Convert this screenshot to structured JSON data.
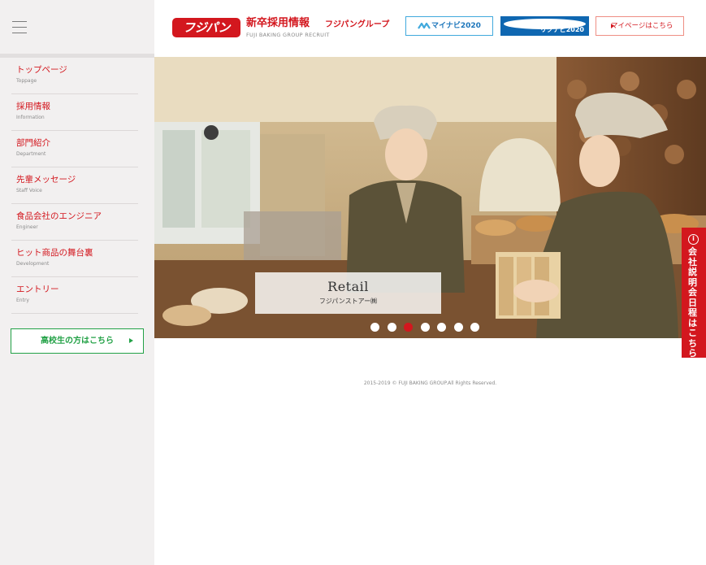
{
  "sidebar": {
    "menu_icon": "hamburger-menu-icon",
    "items": [
      {
        "jp": "トップページ",
        "en": "Toppage"
      },
      {
        "jp": "採用情報",
        "en": "Information"
      },
      {
        "jp": "部門紹介",
        "en": "Department"
      },
      {
        "jp": "先輩メッセージ",
        "en": "Staff Voice"
      },
      {
        "jp": "食品会社のエンジニア",
        "en": "Engineer"
      },
      {
        "jp": "ヒット商品の舞台裏",
        "en": "Development"
      },
      {
        "jp": "エントリー",
        "en": "Entry"
      }
    ],
    "highschool_button": "高校生の方はこちら"
  },
  "header": {
    "logo": "フジパン",
    "title": "新卒採用情報",
    "group": "フジパングループ",
    "subtitle": "FUJI BAKING GROUP RECRUIT",
    "mynavi_label": "マイナビ2020",
    "rikunabi_label": "リクナビ2020",
    "mypage_label": "マイページはこちら"
  },
  "hero": {
    "caption_title": "Retail",
    "caption_sub": "フジパンストアー㈱",
    "slide_count": 7,
    "active_slide": 3
  },
  "side_tab": {
    "icon": "info-icon",
    "text": "会社説明会 日程はこちら"
  },
  "footer": {
    "copyright": "2015-2019 © FUJI BAKING GROUP.All Rights Reserved."
  },
  "colors": {
    "brand_red": "#d3171e",
    "green": "#22a146",
    "mynavi_blue": "#1b75bb",
    "rikunabi_blue": "#0f67b1",
    "sidebar_bg": "#f2f0f0"
  }
}
